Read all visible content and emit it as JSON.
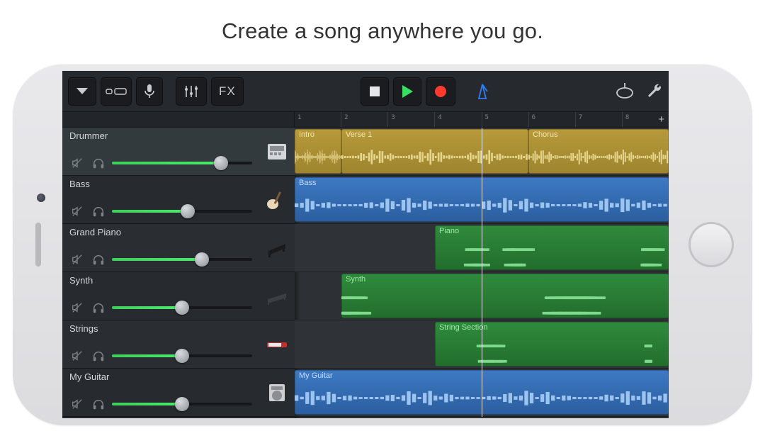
{
  "tagline": "Create a song anywhere you go.",
  "toolbar": {
    "fx_label": "FX"
  },
  "ruler": {
    "bars": [
      "1",
      "2",
      "3",
      "4",
      "5",
      "6",
      "7",
      "8"
    ],
    "playhead_bar": 5.0
  },
  "tracks": [
    {
      "name": "Drummer",
      "muted": true,
      "volume": 0.78,
      "selected": true,
      "instrument": "drum-machine",
      "regions": [
        {
          "label": "Intro",
          "color": "yellow",
          "start": 1.0,
          "end": 2.0,
          "type": "wave"
        },
        {
          "label": "Verse 1",
          "color": "yellow",
          "start": 2.0,
          "end": 6.0,
          "type": "wave"
        },
        {
          "label": "Chorus",
          "color": "yellow",
          "start": 6.0,
          "end": 9.0,
          "type": "wave"
        }
      ]
    },
    {
      "name": "Bass",
      "muted": true,
      "volume": 0.54,
      "selected": false,
      "instrument": "bass-guitar",
      "regions": [
        {
          "label": "Bass",
          "color": "blue",
          "start": 1.0,
          "end": 9.0,
          "type": "wave"
        }
      ]
    },
    {
      "name": "Grand Piano",
      "muted": true,
      "volume": 0.64,
      "selected": false,
      "instrument": "piano",
      "regions": [
        {
          "label": "Piano",
          "color": "green",
          "start": 4.0,
          "end": 9.0,
          "type": "notes"
        }
      ]
    },
    {
      "name": "Synth",
      "muted": true,
      "volume": 0.5,
      "selected": false,
      "instrument": "synth",
      "regions": [
        {
          "label": "Synth",
          "color": "green",
          "start": 2.0,
          "end": 9.0,
          "type": "notes"
        }
      ]
    },
    {
      "name": "Strings",
      "muted": true,
      "volume": 0.5,
      "selected": false,
      "instrument": "strings",
      "regions": [
        {
          "label": "String Section",
          "color": "green",
          "start": 4.0,
          "end": 9.0,
          "type": "notes"
        }
      ]
    },
    {
      "name": "My Guitar",
      "muted": true,
      "volume": 0.5,
      "selected": false,
      "instrument": "amp",
      "regions": [
        {
          "label": "My Guitar",
          "color": "blue",
          "start": 1.0,
          "end": 9.0,
          "type": "wave"
        }
      ]
    }
  ],
  "colors": {
    "green_accent": "#37e063",
    "red_accent": "#ff3b30",
    "blue_accent": "#2f7ef6"
  }
}
